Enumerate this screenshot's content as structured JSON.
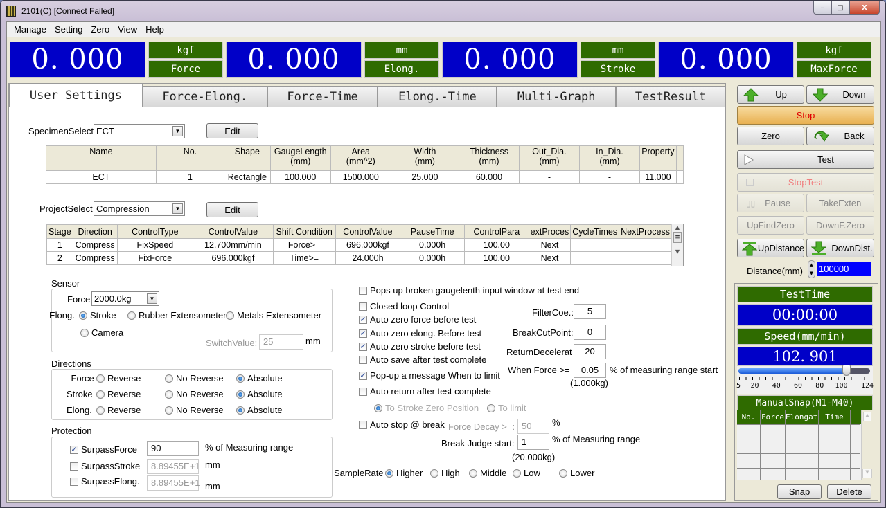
{
  "window": {
    "title": "2101(C)   [Connect Failed]",
    "controls": {
      "minimize": "–",
      "maximize": "□",
      "close": "X"
    }
  },
  "menu": [
    "Manage",
    "Setting",
    "Zero",
    "View",
    "Help"
  ],
  "readouts": [
    {
      "value": "0. 000",
      "unit": "kgf",
      "label": "Force"
    },
    {
      "value": "0. 000",
      "unit": "mm",
      "label": "Elong."
    },
    {
      "value": "0. 000",
      "unit": "mm",
      "label": "Stroke"
    },
    {
      "value": "0. 000",
      "unit": "kgf",
      "label": "MaxForce"
    }
  ],
  "tabs": [
    "User Settings",
    "Force-Elong.",
    "Force-Time",
    "Elong.-Time",
    "Multi-Graph",
    "TestResult"
  ],
  "active_tab": "User Settings",
  "specimen": {
    "label": "SpecimenSelect",
    "value": "ECT",
    "edit_label": "Edit",
    "columns": [
      [
        "Name",
        ""
      ],
      [
        "No.",
        ""
      ],
      [
        "Shape",
        ""
      ],
      [
        "GaugeLength",
        "(mm)"
      ],
      [
        "Area",
        "(mm^2)"
      ],
      [
        "Width",
        "(mm)"
      ],
      [
        "Thickness",
        "(mm)"
      ],
      [
        "Out_Dia.",
        "(mm)"
      ],
      [
        "In_Dia.",
        "(mm)"
      ],
      [
        "Property",
        ""
      ]
    ],
    "rows": [
      [
        "ECT",
        "1",
        "Rectangle",
        "100.000",
        "1500.000",
        "25.000",
        "60.000",
        "-",
        "-",
        "11.000"
      ]
    ]
  },
  "project": {
    "label": "ProjectSelect",
    "value": "Compression",
    "edit_label": "Edit",
    "columns": [
      "Stage",
      "Direction",
      "ControlType",
      "ControlValue",
      "Shift Condition",
      "ControlValue",
      "PauseTime",
      "ControlPara",
      "extProces",
      "CycleTimes",
      "NextProcess"
    ],
    "rows": [
      [
        "1",
        "Compress",
        "FixSpeed",
        "12.700mm/min",
        "Force>=",
        "696.000kgf",
        "0.000h",
        "100.00",
        "Next",
        "",
        ""
      ],
      [
        "2",
        "Compress",
        "FixForce",
        "696.000kgf",
        "Time>=",
        "24.000h",
        "0.000h",
        "100.00",
        "Next",
        "",
        ""
      ]
    ]
  },
  "sensor": {
    "title": "Sensor",
    "force_label": "Force",
    "force_value": "2000.0kg",
    "elong_label": "Elong.",
    "elong_options": [
      "Stroke",
      "Rubber Extensometer",
      "Metals Extensometer",
      "Camera"
    ],
    "elong_selected": "Stroke",
    "switch_label": "SwitchValue:",
    "switch_value": "25",
    "switch_unit": "mm"
  },
  "directions": {
    "title": "Directions",
    "rows": [
      {
        "label": "Force",
        "options": [
          "Reverse",
          "No Reverse",
          "Absolute"
        ],
        "selected": "Absolute"
      },
      {
        "label": "Stroke",
        "options": [
          "Reverse",
          "No Reverse",
          "Absolute"
        ],
        "selected": "Absolute"
      },
      {
        "label": "Elong.",
        "options": [
          "Reverse",
          "No Reverse",
          "Absolute"
        ],
        "selected": "Absolute"
      }
    ]
  },
  "protection": {
    "title": "Protection",
    "rows": [
      {
        "label": "SurpassForce",
        "checked": true,
        "value": "90",
        "unit": "% of Measuring range"
      },
      {
        "label": "SurpassStroke",
        "checked": false,
        "value": "8.89455E+1",
        "unit": "mm"
      },
      {
        "label": "SurpassElong.",
        "checked": false,
        "value": "8.89455E+1",
        "unit": "mm"
      }
    ]
  },
  "options": {
    "checks": [
      {
        "label": "Pops up broken gaugelenth input window at test end",
        "checked": false
      },
      {
        "label": "Closed loop Control",
        "checked": false
      },
      {
        "label": "Auto zero force before test",
        "checked": true
      },
      {
        "label": "Auto zero elong. Before test",
        "checked": true
      },
      {
        "label": "Auto zero stroke before test",
        "checked": true
      },
      {
        "label": "Auto save after test complete",
        "checked": false
      },
      {
        "label": "Pop-up a message When to limit",
        "checked": true
      },
      {
        "label": "Auto return after test complete",
        "checked": false
      },
      {
        "label": "Auto stop @ break",
        "checked": false
      }
    ],
    "filter_label": "FilterCoe.:",
    "filter_value": "5",
    "breakcut_label": "BreakCutPoint:",
    "breakcut_value": "0",
    "returndec_label": "ReturnDecelerat",
    "returndec_value": "20",
    "whenforce_label": "When Force >=",
    "whenforce_value": "0.05",
    "whenforce_unit": "% of measuring range start",
    "whenforce_kg": "(1.000kg)",
    "return_options": [
      "To Stroke Zero Position",
      "To limit"
    ],
    "return_selected": "To Stroke Zero Position",
    "decay_label": "Force Decay >=:",
    "decay_value": "50",
    "decay_unit": "%",
    "breakjudge_label": "Break Judge start:",
    "breakjudge_value": "1",
    "breakjudge_unit": "% of Measuring range",
    "breakjudge_kg": "(20.000kg)",
    "samplerate_label": "SampleRate",
    "samplerate_options": [
      "Higher",
      "High",
      "Middle",
      "Low",
      "Lower"
    ],
    "samplerate_selected": "Higher"
  },
  "side": {
    "up": "Up",
    "down": "Down",
    "stop": "Stop",
    "zero": "Zero",
    "back": "Back",
    "test": "Test",
    "stoptest": "StopTest",
    "pause": "Pause",
    "takeexten": "TakeExten",
    "upfindzero": "UpFindZero",
    "downfzero": "DownF.Zero",
    "updistance": "UpDistance",
    "downdist": "DownDist.",
    "distance_label": "Distance(mm)",
    "distance_value": "100000",
    "testtime_label": "TestTime",
    "testtime_value": "00:00:00",
    "speed_label": "Speed(mm/min)",
    "speed_value": "102. 901",
    "slider": {
      "min": 5,
      "max": 124,
      "value": 102.901,
      "ticks": [
        "5",
        "20",
        "40",
        "60",
        "80",
        "100",
        "124"
      ]
    },
    "snap_title": "ManualSnap(M1-M40)",
    "snap_columns": [
      "No.",
      "Force",
      "Elongation",
      "Time"
    ],
    "snap_label": "Snap",
    "delete_label": "Delete"
  },
  "colors": {
    "readout_bg": "#0000c8",
    "label_bg": "#2f6b00",
    "stop_bg": "#f0c070",
    "stop_text": "#e00000"
  }
}
